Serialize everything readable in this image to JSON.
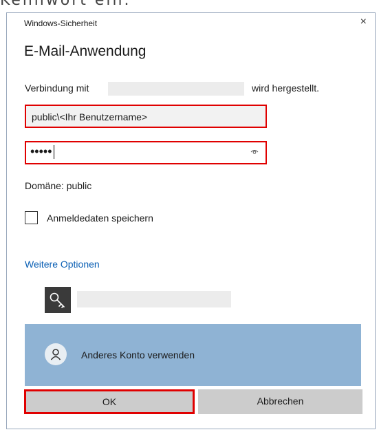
{
  "page_caption": "Kennwort ein.",
  "window": {
    "title": "Windows-Sicherheit",
    "close_glyph": "×"
  },
  "app_title": "E-Mail-Anwendung",
  "connection": {
    "prefix": "Verbindung mit",
    "suffix": "wird hergestellt."
  },
  "username_field": {
    "value": "public\\<Ihr Benutzername>"
  },
  "password_field": {
    "masked_value": "•••••",
    "reveal_icon": "eye-icon"
  },
  "domain_text": "Domäne: public",
  "remember": {
    "label": "Anmeldedaten speichern",
    "checked": false
  },
  "more_options_label": "Weitere Optionen",
  "saved_account": {
    "icon": "key-icon"
  },
  "other_account": {
    "label": "Anderes Konto verwenden",
    "icon": "person-icon"
  },
  "buttons": {
    "ok": "OK",
    "cancel": "Abbrechen"
  },
  "colors": {
    "highlight": "#e00000",
    "accent_link": "#0a5fb4",
    "selected_tile": "#8fb3d4",
    "button_bg": "#cccccc"
  }
}
